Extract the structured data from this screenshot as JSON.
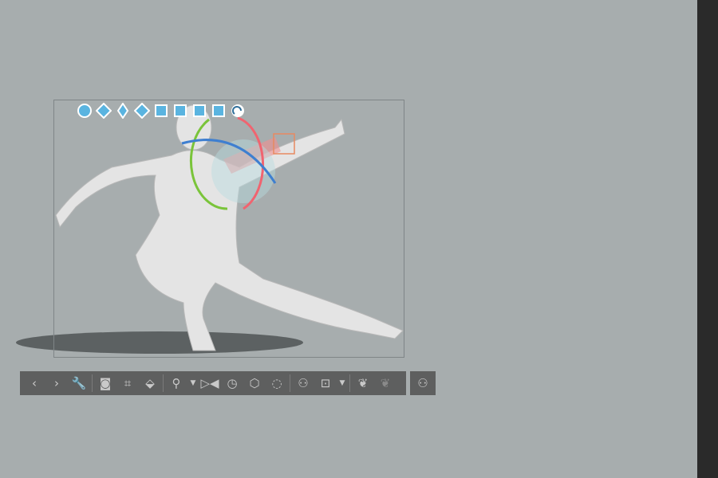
{
  "colors": {
    "background": "#a7adae",
    "side_panel": "#2a2a2a",
    "toolbar": "#5e5f5f",
    "toolbar_icon": "#c9c9c9",
    "manipulator_icon": "#5ab4e0",
    "rotate_x": "#f06470",
    "rotate_y": "#7ac43a",
    "rotate_z": "#3e7fd0",
    "bone_selected": "#e88a60"
  },
  "manipulator_icons": [
    "camera-rotate-icon",
    "camera-pan-icon",
    "camera-dolly-icon",
    "move-plane-icon",
    "rotate-icon",
    "rotate-view-icon",
    "rotate-plane-icon",
    "move-3d-icon",
    "magnet-snap-icon"
  ],
  "toolbar": {
    "groups": [
      [
        {
          "icon": "previous-icon",
          "glyph": "‹"
        },
        {
          "icon": "next-icon",
          "glyph": "›"
        },
        {
          "icon": "wrench-icon",
          "glyph": "🔧"
        }
      ],
      [
        {
          "icon": "camera-icon",
          "glyph": "◙"
        },
        {
          "icon": "fit-view-icon",
          "glyph": "⌗"
        },
        {
          "icon": "ground-icon",
          "glyph": "⬙"
        }
      ],
      [
        {
          "icon": "pose-add-icon",
          "glyph": "⚲"
        },
        {
          "icon": "dropdown-icon",
          "glyph": "▼",
          "dd": true
        },
        {
          "icon": "flip-pose-icon",
          "glyph": "▷◀"
        },
        {
          "icon": "reset-pose-icon",
          "glyph": "◷"
        },
        {
          "icon": "reset-rotation-icon",
          "glyph": "⬡"
        },
        {
          "icon": "reset-all-icon",
          "glyph": "◌"
        }
      ],
      [
        {
          "icon": "register-body-shape-icon",
          "glyph": "⚇"
        },
        {
          "icon": "body-shape-icon",
          "glyph": "⊡"
        },
        {
          "icon": "dropdown-icon",
          "glyph": "▼",
          "dd": true
        }
      ],
      [
        {
          "icon": "lock-joint-icon",
          "glyph": "❦"
        },
        {
          "icon": "unlock-joint-icon",
          "glyph": "❦",
          "dim": true
        }
      ]
    ],
    "extra": {
      "icon": "body-size-icon",
      "glyph": "⚇"
    }
  }
}
